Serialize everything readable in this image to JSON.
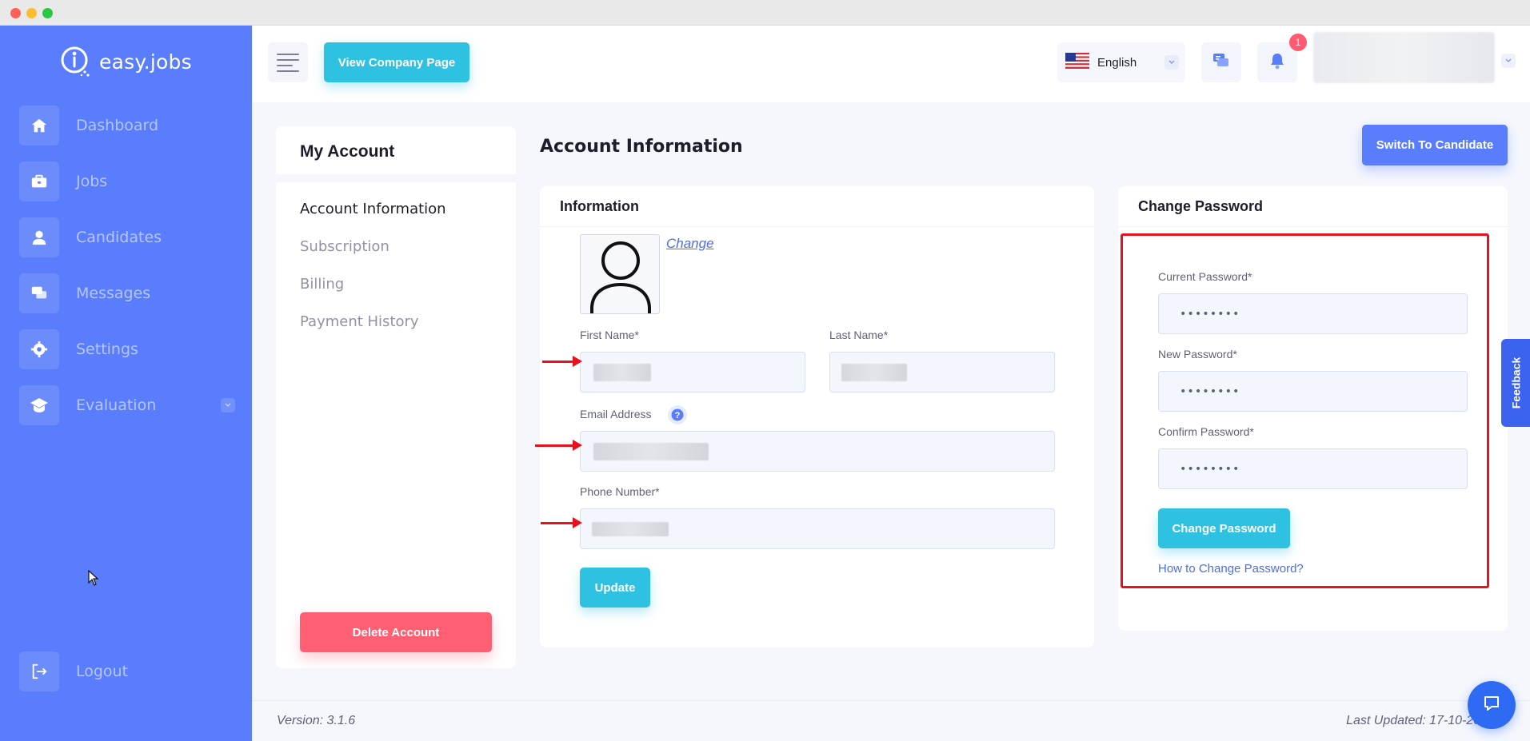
{
  "brand": {
    "name": "easy.jobs"
  },
  "sidebar": {
    "items": [
      {
        "label": "Dashboard",
        "icon": "home-icon"
      },
      {
        "label": "Jobs",
        "icon": "briefcase-icon"
      },
      {
        "label": "Candidates",
        "icon": "user-icon"
      },
      {
        "label": "Messages",
        "icon": "chat-icon"
      },
      {
        "label": "Settings",
        "icon": "gear-icon"
      },
      {
        "label": "Evaluation",
        "icon": "graduation-cap-icon"
      }
    ],
    "logout": {
      "label": "Logout",
      "icon": "logout-icon"
    }
  },
  "topbar": {
    "view_company_label": "View Company Page",
    "language": "English",
    "notification_count": "1"
  },
  "account_menu": {
    "title": "My Account",
    "items": [
      "Account Information",
      "Subscription",
      "Billing",
      "Payment History"
    ],
    "delete_label": "Delete Account"
  },
  "main": {
    "heading": "Account Information",
    "switch_label": "Switch To Candidate"
  },
  "info_card": {
    "title": "Information",
    "change_photo_label": "Change",
    "first_name_label": "First Name*",
    "last_name_label": "Last Name*",
    "email_label": "Email Address",
    "phone_label": "Phone Number*",
    "update_label": "Update"
  },
  "password_card": {
    "title": "Change Password",
    "current_label": "Current Password*",
    "current_value": "••••••••",
    "new_label": "New Password*",
    "new_value": "••••••••",
    "confirm_label": "Confirm Password*",
    "confirm_value": "••••••••",
    "submit_label": "Change Password",
    "help_link": "How to Change Password?"
  },
  "feedback_label": "Feedback",
  "footer": {
    "version": "Version: 3.1.6",
    "last_updated": "Last Updated: 17-10-2022"
  },
  "colors": {
    "sidebar": "#597dfc",
    "accent_cyan": "#2fc1e1",
    "danger": "#ff5e73",
    "highlight_red": "#e8121f"
  }
}
